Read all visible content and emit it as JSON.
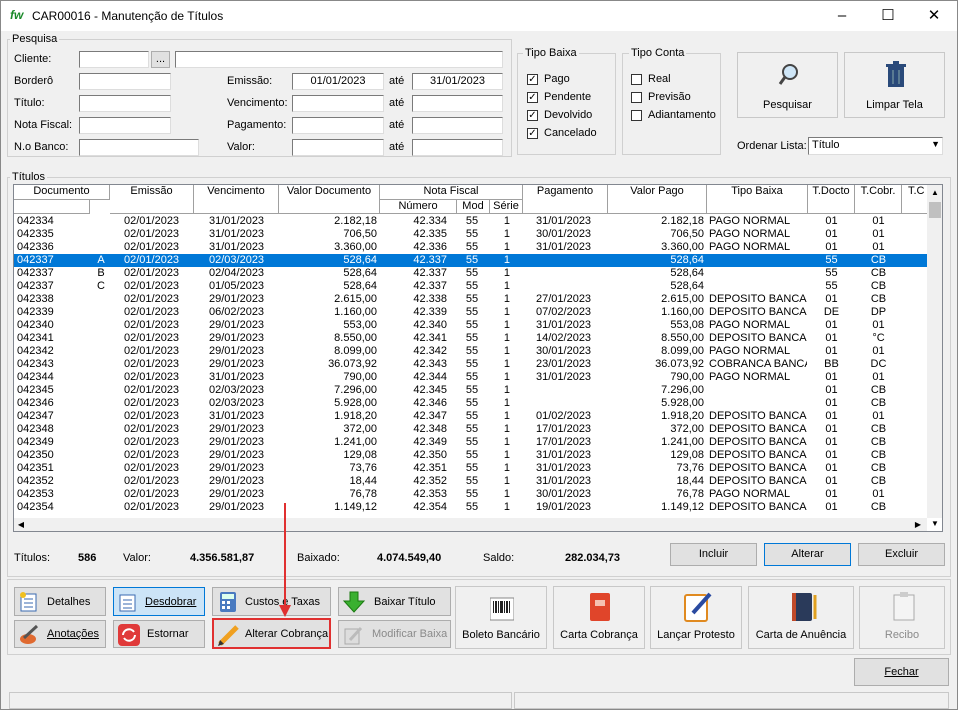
{
  "window": {
    "title": "CAR00016 - Manutenção de Títulos",
    "logo": "fw"
  },
  "search": {
    "group_label": "Pesquisa",
    "cliente_label": "Cliente:",
    "cliente_btn": "...",
    "bordero_label": "Borderô",
    "titulo_label": "Título:",
    "nota_label": "Nota Fiscal:",
    "banco_label": "N.o Banco:",
    "emissao_label": "Emissão:",
    "emissao_from": "01/01/2023",
    "emissao_to": "31/01/2023",
    "vencimento_label": "Vencimento:",
    "pagamento_label": "Pagamento:",
    "valor_label": "Valor:",
    "ate": "até"
  },
  "tipo_baixa": {
    "label": "Tipo Baixa",
    "items": [
      {
        "label": "Pago",
        "checked": true
      },
      {
        "label": "Pendente",
        "checked": true
      },
      {
        "label": "Devolvido",
        "checked": true
      },
      {
        "label": "Cancelado",
        "checked": true
      }
    ]
  },
  "tipo_conta": {
    "label": "Tipo Conta",
    "items": [
      {
        "label": "Real",
        "checked": false
      },
      {
        "label": "Previsão",
        "checked": false
      },
      {
        "label": "Adiantamento",
        "checked": false
      }
    ]
  },
  "actions": {
    "pesquisar": "Pesquisar",
    "limpar": "Limpar Tela",
    "ordenar_label": "Ordenar Lista:",
    "ordenar_value": "Título"
  },
  "titulos": {
    "group_label": "Títulos",
    "columns": {
      "documento": "Documento",
      "emissao": "Emissão",
      "vencimento": "Vencimento",
      "valor_doc": "Valor Documento",
      "nota": "Nota Fiscal",
      "numero": "Número",
      "mod": "Mod",
      "serie": "Série",
      "pagamento": "Pagamento",
      "valor_pago": "Valor Pago",
      "tipo_baixa": "Tipo Baixa",
      "t_docto": "T.Docto",
      "t_cobr": "T.Cobr.",
      "t_extra": "T.C"
    },
    "rows": [
      [
        "042334",
        "",
        "02/01/2023",
        "31/01/2023",
        "2.182,18",
        "42.334",
        "55",
        "1",
        "31/01/2023",
        "2.182,18",
        "PAGO NORMAL",
        "01",
        "01"
      ],
      [
        "042335",
        "",
        "02/01/2023",
        "31/01/2023",
        "706,50",
        "42.335",
        "55",
        "1",
        "30/01/2023",
        "706,50",
        "PAGO NORMAL",
        "01",
        "01"
      ],
      [
        "042336",
        "",
        "02/01/2023",
        "31/01/2023",
        "3.360,00",
        "42.336",
        "55",
        "1",
        "31/01/2023",
        "3.360,00",
        "PAGO NORMAL",
        "01",
        "01"
      ],
      [
        "042337",
        "A",
        "02/01/2023",
        "02/03/2023",
        "528,64",
        "42.337",
        "55",
        "1",
        "",
        "528,64",
        "",
        "55",
        "CB"
      ],
      [
        "042337",
        "B",
        "02/01/2023",
        "02/04/2023",
        "528,64",
        "42.337",
        "55",
        "1",
        "",
        "528,64",
        "",
        "55",
        "CB"
      ],
      [
        "042337",
        "C",
        "02/01/2023",
        "01/05/2023",
        "528,64",
        "42.337",
        "55",
        "1",
        "",
        "528,64",
        "",
        "55",
        "CB"
      ],
      [
        "042338",
        "",
        "02/01/2023",
        "29/01/2023",
        "2.615,00",
        "42.338",
        "55",
        "1",
        "27/01/2023",
        "2.615,00",
        "DEPOSITO BANCA",
        "01",
        "CB"
      ],
      [
        "042339",
        "",
        "02/01/2023",
        "06/02/2023",
        "1.160,00",
        "42.339",
        "55",
        "1",
        "07/02/2023",
        "1.160,00",
        "DEPOSITO BANCA",
        "DE",
        "DP"
      ],
      [
        "042340",
        "",
        "02/01/2023",
        "29/01/2023",
        "553,00",
        "42.340",
        "55",
        "1",
        "31/01/2023",
        "553,08",
        "PAGO NORMAL",
        "01",
        "01"
      ],
      [
        "042341",
        "",
        "02/01/2023",
        "29/01/2023",
        "8.550,00",
        "42.341",
        "55",
        "1",
        "14/02/2023",
        "8.550,00",
        "DEPOSITO BANCA",
        "01",
        "°C"
      ],
      [
        "042342",
        "",
        "02/01/2023",
        "29/01/2023",
        "8.099,00",
        "42.342",
        "55",
        "1",
        "30/01/2023",
        "8.099,00",
        "PAGO NORMAL",
        "01",
        "01"
      ],
      [
        "042343",
        "",
        "02/01/2023",
        "29/01/2023",
        "36.073,92",
        "42.343",
        "55",
        "1",
        "23/01/2023",
        "36.073,92",
        "COBRANCA BANCA",
        "BB",
        "DC"
      ],
      [
        "042344",
        "",
        "02/01/2023",
        "31/01/2023",
        "790,00",
        "42.344",
        "55",
        "1",
        "31/01/2023",
        "790,00",
        "PAGO NORMAL",
        "01",
        "01"
      ],
      [
        "042345",
        "",
        "02/01/2023",
        "02/03/2023",
        "7.296,00",
        "42.345",
        "55",
        "1",
        "",
        "7.296,00",
        "",
        "01",
        "CB"
      ],
      [
        "042346",
        "",
        "02/01/2023",
        "02/03/2023",
        "5.928,00",
        "42.346",
        "55",
        "1",
        "",
        "5.928,00",
        "",
        "01",
        "CB"
      ],
      [
        "042347",
        "",
        "02/01/2023",
        "31/01/2023",
        "1.918,20",
        "42.347",
        "55",
        "1",
        "01/02/2023",
        "1.918,20",
        "DEPOSITO BANCA",
        "01",
        "01"
      ],
      [
        "042348",
        "",
        "02/01/2023",
        "29/01/2023",
        "372,00",
        "42.348",
        "55",
        "1",
        "17/01/2023",
        "372,00",
        "DEPOSITO BANCA",
        "01",
        "CB"
      ],
      [
        "042349",
        "",
        "02/01/2023",
        "29/01/2023",
        "1.241,00",
        "42.349",
        "55",
        "1",
        "17/01/2023",
        "1.241,00",
        "DEPOSITO BANCA",
        "01",
        "CB"
      ],
      [
        "042350",
        "",
        "02/01/2023",
        "29/01/2023",
        "129,08",
        "42.350",
        "55",
        "1",
        "31/01/2023",
        "129,08",
        "DEPOSITO BANCA",
        "01",
        "CB"
      ],
      [
        "042351",
        "",
        "02/01/2023",
        "29/01/2023",
        "73,76",
        "42.351",
        "55",
        "1",
        "31/01/2023",
        "73,76",
        "DEPOSITO BANCA",
        "01",
        "CB"
      ],
      [
        "042352",
        "",
        "02/01/2023",
        "29/01/2023",
        "18,44",
        "42.352",
        "55",
        "1",
        "31/01/2023",
        "18,44",
        "DEPOSITO BANCA",
        "01",
        "CB"
      ],
      [
        "042353",
        "",
        "02/01/2023",
        "29/01/2023",
        "76,78",
        "42.353",
        "55",
        "1",
        "30/01/2023",
        "76,78",
        "PAGO NORMAL",
        "01",
        "01"
      ],
      [
        "042354",
        "",
        "02/01/2023",
        "29/01/2023",
        "1.149,12",
        "42.354",
        "55",
        "1",
        "19/01/2023",
        "1.149,12",
        "DEPOSITO BANCA",
        "01",
        "CB"
      ]
    ]
  },
  "totals": {
    "titulos_label": "Títulos:",
    "titulos": "586",
    "valor_label": "Valor:",
    "valor": "4.356.581,87",
    "baixado_label": "Baixado:",
    "baixado": "4.074.549,40",
    "saldo_label": "Saldo:",
    "saldo": "282.034,73"
  },
  "grid_buttons": {
    "incluir": "Incluir",
    "alterar": "Alterar",
    "excluir": "Excluir"
  },
  "bottom": {
    "detalhes": "Detalhes",
    "desdobrar": "Desdobrar",
    "custos": "Custos e Taxas",
    "baixar": "Baixar Título",
    "anotacoes": "Anotações",
    "estornar": "Estornar",
    "alterar_cobranca": "Alterar Cobrança",
    "modificar": "Modificar Baixa",
    "boleto": "Boleto Bancário",
    "carta_cobranca": "Carta Cobrança",
    "protesto": "Lançar Protesto",
    "anuencia": "Carta de Anuência",
    "recibo": "Recibo",
    "fechar": "Fechar"
  },
  "colors": {
    "selection": "#0078d7",
    "highlight": "#e03030"
  }
}
